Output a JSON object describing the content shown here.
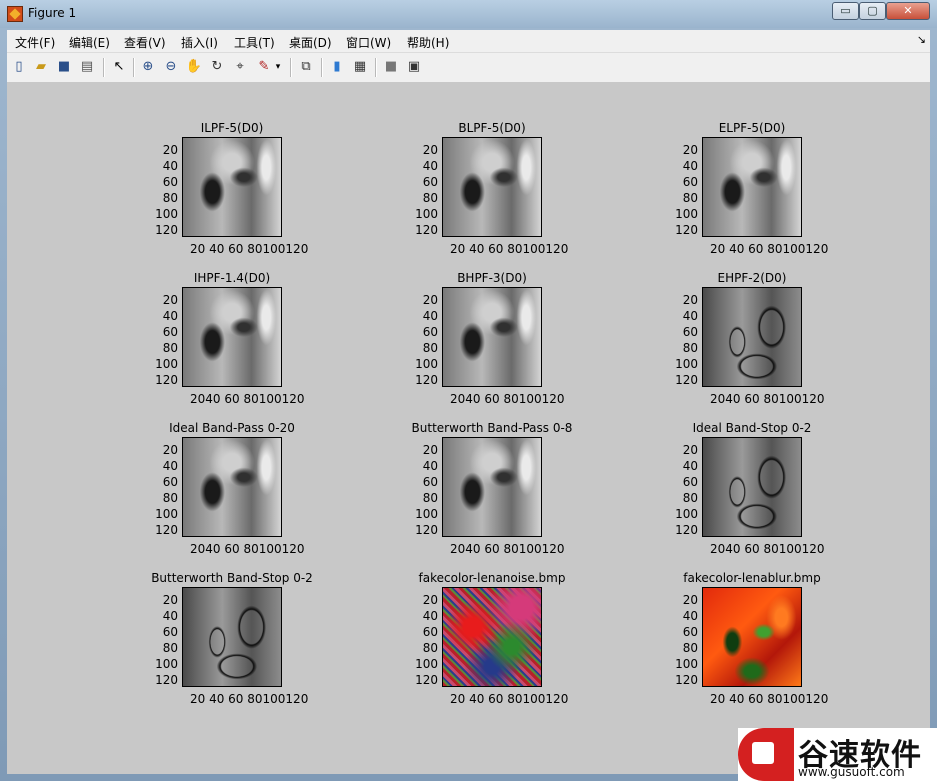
{
  "window": {
    "title": "Figure 1",
    "min_label": "▭",
    "max_label": "▢",
    "close_label": "✕"
  },
  "menu": [
    {
      "label": "文件(F)"
    },
    {
      "label": "编辑(E)"
    },
    {
      "label": "查看(V)"
    },
    {
      "label": "插入(I)"
    },
    {
      "label": "工具(T)"
    },
    {
      "label": "桌面(D)"
    },
    {
      "label": "窗口(W)"
    },
    {
      "label": "帮助(H)"
    }
  ],
  "menu_overflow": "↘",
  "toolbar": [
    {
      "icon": "new-figure-icon"
    },
    {
      "icon": "open-file-icon"
    },
    {
      "icon": "save-icon"
    },
    {
      "icon": "print-icon"
    },
    {
      "icon": "pointer-icon"
    },
    {
      "icon": "zoom-in-icon"
    },
    {
      "icon": "zoom-out-icon"
    },
    {
      "icon": "pan-icon"
    },
    {
      "icon": "rotate-3d-icon"
    },
    {
      "icon": "data-cursor-icon"
    },
    {
      "icon": "brush-icon"
    },
    {
      "icon": "brush-dropdown-icon"
    },
    {
      "icon": "link-plot-icon"
    },
    {
      "icon": "colorbar-icon"
    },
    {
      "icon": "legend-icon"
    },
    {
      "icon": "hide-plot-tools-icon"
    },
    {
      "icon": "show-plot-tools-icon"
    }
  ],
  "yticks": [
    "20",
    "40",
    "60",
    "80",
    "100",
    "120"
  ],
  "xticks_a": "20 40 60 80100120",
  "xticks_b": "2040 60 80100120",
  "panels": [
    {
      "title": "ILPF-5(D0)",
      "img": "gray",
      "xticks": "a"
    },
    {
      "title": "BLPF-5(D0)",
      "img": "gray",
      "xticks": "a"
    },
    {
      "title": "ELPF-5(D0)",
      "img": "gray",
      "xticks": "a"
    },
    {
      "title": "IHPF-1.4(D0)",
      "img": "gray",
      "xticks": "b"
    },
    {
      "title": "BHPF-3(D0)",
      "img": "gray",
      "xticks": "b"
    },
    {
      "title": "EHPF-2(D0)",
      "img": "edges",
      "xticks": "b"
    },
    {
      "title": "Ideal Band-Pass 0-20",
      "img": "gray",
      "xticks": "b"
    },
    {
      "title": "Butterworth Band-Pass 0-8",
      "img": "gray",
      "xticks": "b"
    },
    {
      "title": "Ideal Band-Stop 0-2",
      "img": "edges",
      "xticks": "b"
    },
    {
      "title": "Butterworth Band-Stop 0-2",
      "img": "edges",
      "xticks": "a"
    },
    {
      "title": "fakecolor-lenanoise.bmp",
      "img": "noise",
      "xticks": "a"
    },
    {
      "title": "fakecolor-lenablur.bmp",
      "img": "blur",
      "xticks": "a"
    }
  ],
  "watermark": {
    "name": "谷速软件",
    "url": "www.gusuoft.com"
  }
}
